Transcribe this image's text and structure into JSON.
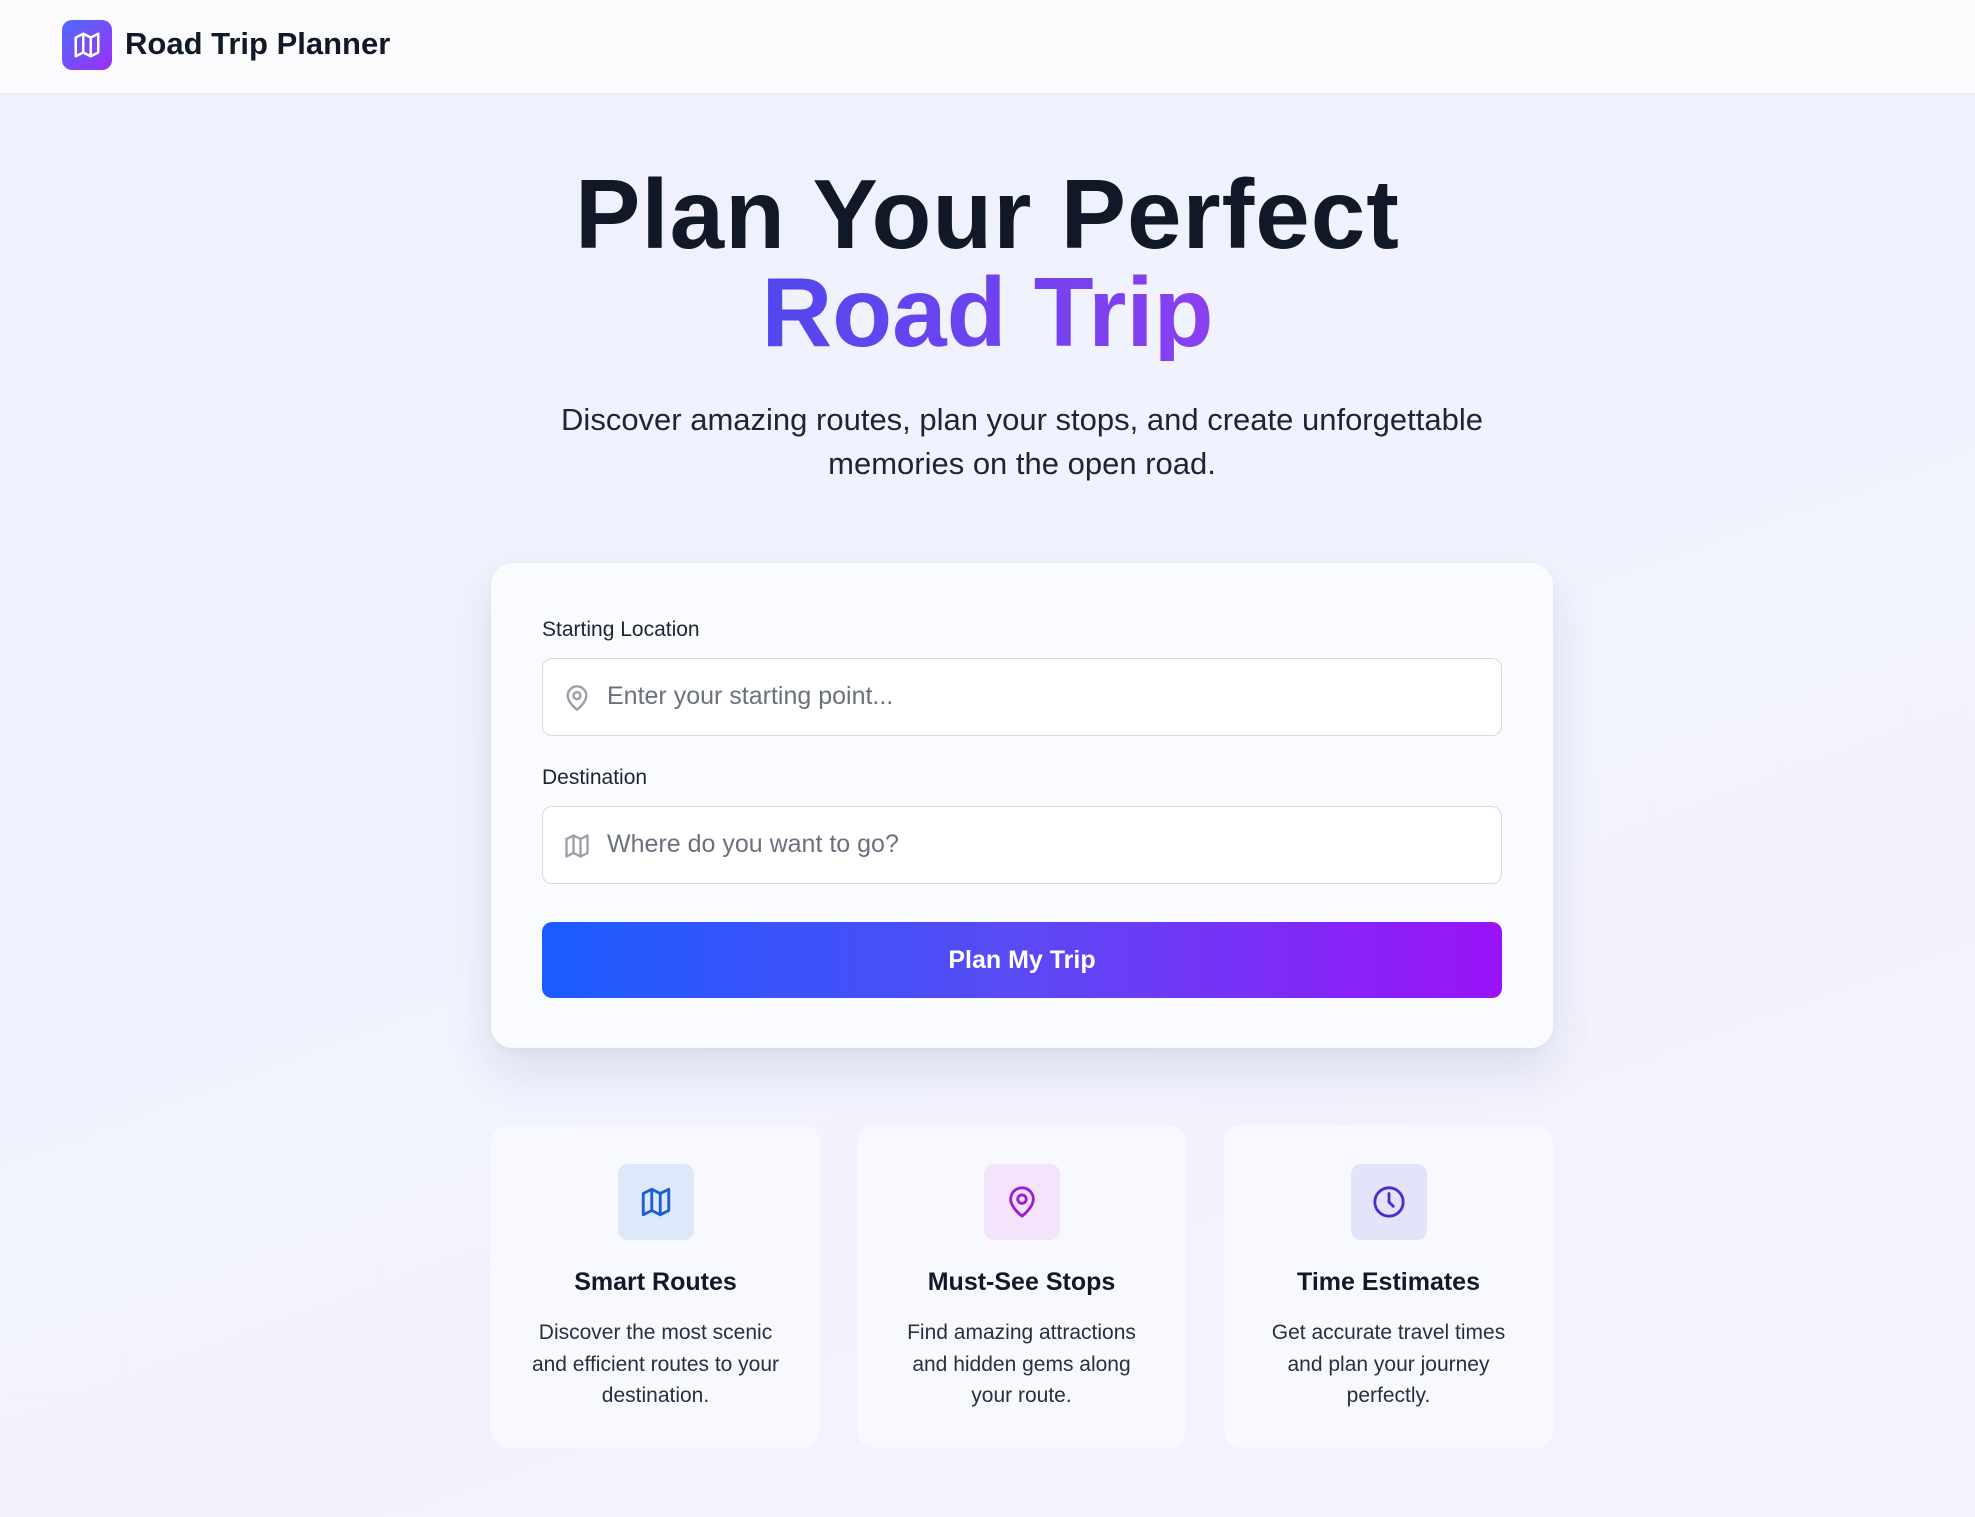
{
  "header": {
    "title": "Road Trip Planner",
    "logo_icon": "map-icon"
  },
  "hero": {
    "headline_line1": "Plan Your Perfect",
    "headline_line2": "Road Trip",
    "subtitle": "Discover amazing routes, plan your stops, and create unforgettable memories on the open road."
  },
  "form": {
    "start": {
      "label": "Starting Location",
      "placeholder": "Enter your starting point...",
      "value": "",
      "icon": "map-pin-icon"
    },
    "destination": {
      "label": "Destination",
      "placeholder": "Where do you want to go?",
      "value": "",
      "icon": "map-icon"
    },
    "submit_label": "Plan My Trip"
  },
  "features": [
    {
      "icon": "map-icon",
      "title": "Smart Routes",
      "description": "Discover the most scenic and efficient routes to your destination."
    },
    {
      "icon": "map-pin-icon",
      "title": "Must-See Stops",
      "description": "Find amazing attractions and hidden gems along your route."
    },
    {
      "icon": "clock-icon",
      "title": "Time Estimates",
      "description": "Get accurate travel times and plan your journey perfectly."
    }
  ],
  "colors": {
    "brand_gradient_start": "#1a5cff",
    "brand_gradient_end": "#9b12f8",
    "accent_text_start": "#5147ee",
    "accent_text_end": "#8b3ff0",
    "feature_routes_icon": "#1d5bd8",
    "feature_stops_icon": "#a019d6",
    "feature_time_icon": "#4b2bd1"
  }
}
